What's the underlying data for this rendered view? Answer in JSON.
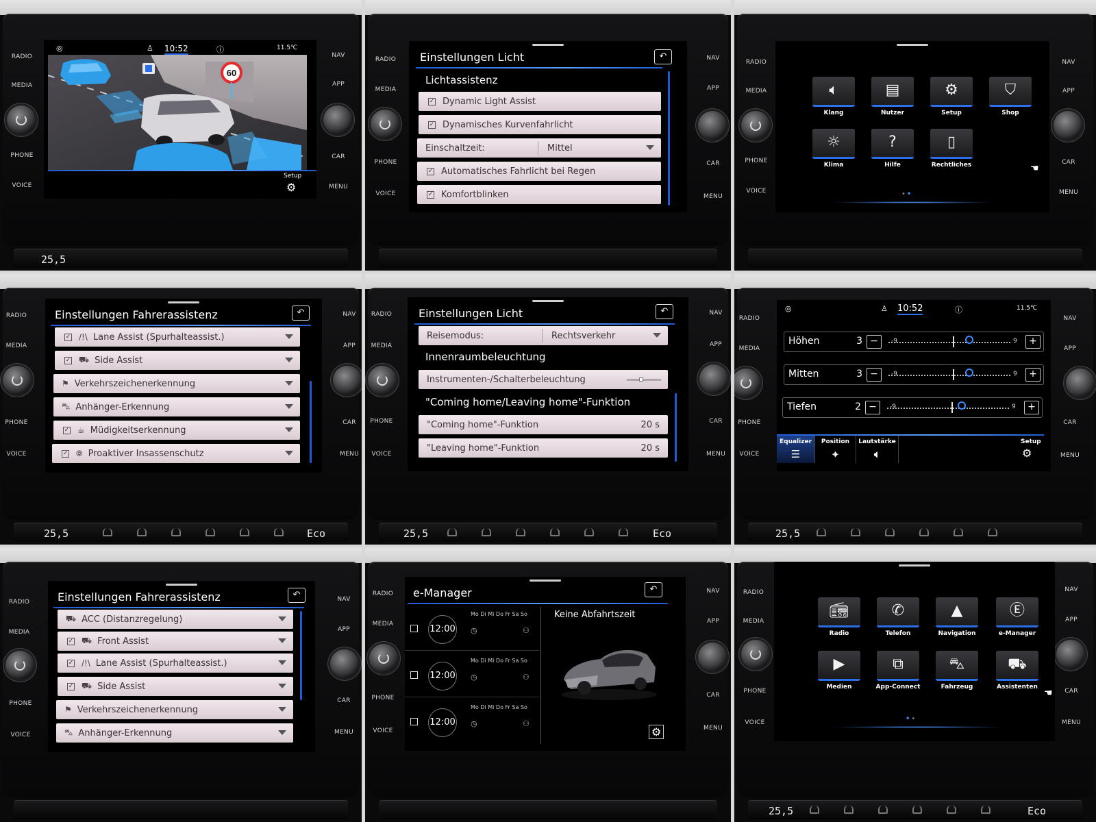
{
  "hardware": {
    "radio": "RADIO",
    "media": "MEDIA",
    "phone": "PHONE",
    "voice": "VOICE",
    "nav": "NAV",
    "app": "APP",
    "car": "CAR",
    "menu": "MENU"
  },
  "climate": {
    "temp_a": "25,5",
    "temp_b": "25,5",
    "eco": "Eco"
  },
  "p1": {
    "time": "10:52",
    "outside_temp": "11.5℃",
    "speed_sign": "60",
    "setup_label": "Setup"
  },
  "p2": {
    "title": "Einstellungen Licht",
    "section": "Lichtassistenz",
    "items": [
      "Dynamic Light Assist",
      "Dynamisches Kurvenfahrlicht"
    ],
    "switch_label": "Einschaltzeit:",
    "switch_value": "Mittel",
    "items2": [
      "Automatisches Fahrlicht bei Regen",
      "Komfortblinken"
    ]
  },
  "p3": {
    "tiles": [
      "Klang",
      "Nutzer",
      "Setup",
      "Shop",
      "Klima",
      "Hilfe",
      "Rechtliches"
    ]
  },
  "p4": {
    "title": "Einstellungen Fahrerassistenz",
    "rows": [
      {
        "sym": "/!\\",
        "label": "Lane Assist (Spurhalteassist.)",
        "check": true
      },
      {
        "sym": "⛟",
        "label": "Side Assist",
        "check": true
      },
      {
        "sym": "⚑",
        "label": "Verkehrszeichenerkennung",
        "check": false
      },
      {
        "sym": "⛍",
        "label": "Anhänger-Erkennung",
        "check": false
      },
      {
        "sym": "☕",
        "label": "Müdigkeitserkennung",
        "check": true
      },
      {
        "sym": "⦾",
        "label": "Proaktiver Insassenschutz",
        "check": true
      }
    ]
  },
  "p5": {
    "title": "Einstellungen Licht",
    "reise_label": "Reisemodus:",
    "reise_value": "Rechtsverkehr",
    "section1": "Innenraumbeleuchtung",
    "instr_label": "Instrumenten-/Schalterbeleuchtung",
    "section2": "\"Coming home/Leaving home\"-Funktion",
    "coming_label": "\"Coming home\"-Funktion",
    "coming_value": "20 s",
    "leaving_label": "\"Leaving home\"-Funktion",
    "leaving_value": "20 s"
  },
  "p6": {
    "time": "10:52",
    "outside_temp": "11.5℃",
    "eq": [
      {
        "name": "Höhen",
        "value": "3",
        "level": 3
      },
      {
        "name": "Mitten",
        "value": "3",
        "level": 3
      },
      {
        "name": "Tiefen",
        "value": "2",
        "level": 2
      }
    ],
    "min": "-9",
    "max": "9",
    "minus": "−",
    "plus": "+",
    "tabs": [
      "Equalizer",
      "Position",
      "Lautstärke"
    ],
    "setup_label": "Setup"
  },
  "p7": {
    "title": "Einstellungen Fahrerassistenz",
    "rows": [
      {
        "sym": "⛟",
        "label": "ACC (Distanzregelung)",
        "check": false
      },
      {
        "sym": "⛟",
        "label": "Front Assist",
        "check": true
      },
      {
        "sym": "/!\\",
        "label": "Lane Assist (Spurhalteassist.)",
        "check": true
      },
      {
        "sym": "⛟",
        "label": "Side Assist",
        "check": true
      },
      {
        "sym": "⚑",
        "label": "Verkehrszeichenerkennung",
        "check": false
      },
      {
        "sym": "⛍",
        "label": "Anhänger-Erkennung",
        "check": false
      }
    ]
  },
  "p8": {
    "title": "e-Manager",
    "no_departure": "Keine Abfahrtszeit",
    "days": "Mo Di Mi Do Fr Sa So",
    "alarms": [
      "12:00",
      "12:00",
      "12:00"
    ]
  },
  "p9": {
    "tiles": [
      "Radio",
      "Telefon",
      "Navigation",
      "e-Manager",
      "Medien",
      "App-Connect",
      "Fahrzeug",
      "Assistenten"
    ]
  }
}
